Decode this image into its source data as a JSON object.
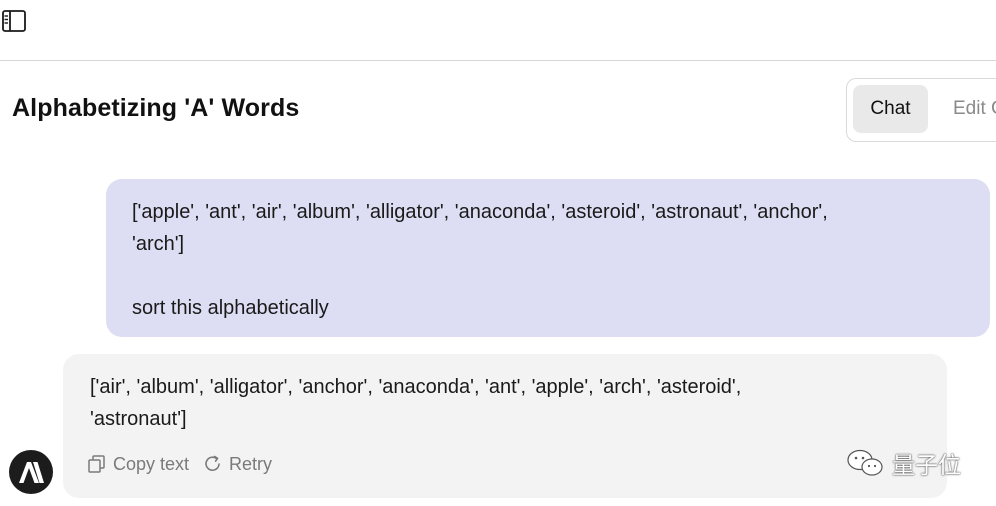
{
  "conversation": {
    "title": "Alphabetizing 'A' Words"
  },
  "mode_switch": {
    "chat_label": "Chat",
    "edit_label": "Edit C"
  },
  "user_message": {
    "line1": "['apple', 'ant', 'air', 'album', 'alligator', 'anaconda', 'asteroid', 'astronaut', 'anchor',",
    "line2": "'arch']",
    "line3": "sort this alphabetically"
  },
  "assistant_message": {
    "line1": "['air', 'album', 'alligator', 'anchor', 'anaconda', 'ant', 'apple', 'arch', 'asteroid',",
    "line2": "'astronaut']",
    "copy_label": "Copy text",
    "retry_label": "Retry"
  },
  "watermark": {
    "text": "量子位"
  },
  "icons": {
    "sidebar_toggle": "sidebar-toggle-icon",
    "copy": "copy-icon",
    "retry": "retry-icon",
    "avatar": "anthropic-logo-icon",
    "watermark": "wechat-icon"
  },
  "colors": {
    "user_bubble": "#dddef3",
    "assistant_bubble": "#f3f3f3",
    "active_tab": "#e9e9e9",
    "avatar_bg": "#1c1c1c"
  }
}
